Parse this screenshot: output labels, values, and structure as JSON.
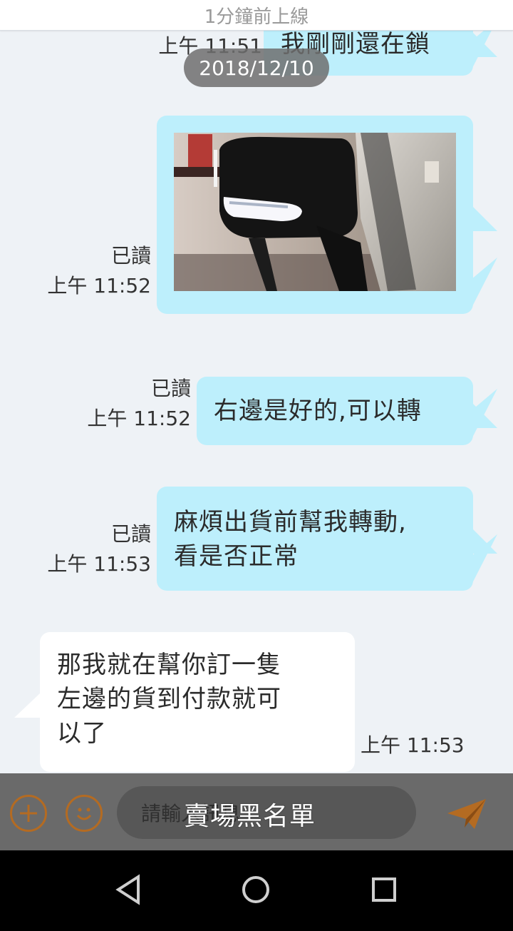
{
  "header": {
    "status": "1分鐘前上線"
  },
  "date_separator": "2018/12/10",
  "messages": [
    {
      "type": "text",
      "direction": "out",
      "text": "我剛剛還在鎖",
      "time": "上午 11:51"
    },
    {
      "type": "image",
      "direction": "out",
      "read": "已讀",
      "time": "上午 11:52"
    },
    {
      "type": "text",
      "direction": "out",
      "text": "右邊是好的,可以轉",
      "read": "已讀",
      "time": "上午 11:52"
    },
    {
      "type": "text",
      "direction": "out",
      "text": "麻煩出貨前幫我轉動,\n看是否正常",
      "read": "已讀",
      "time": "上午 11:53"
    },
    {
      "type": "text",
      "direction": "in",
      "text": "那我就在幫你訂一隻\n左邊的貨到付款就可\n以了",
      "time": "上午 11:53"
    }
  ],
  "composer": {
    "placeholder": "請輸入訊息",
    "add_icon": "plus-circle-icon",
    "emoji_icon": "smiley-icon",
    "send_icon": "paper-plane-icon"
  },
  "watermark": "賣場黑名單",
  "nav": {
    "back_icon": "back-triangle-icon",
    "home_icon": "home-circle-icon",
    "recents_icon": "recents-square-icon"
  },
  "colors": {
    "out_bubble": "#bdeffc",
    "in_bubble": "#ffffff",
    "accent": "#b46b22",
    "background": "#eef2f6"
  }
}
